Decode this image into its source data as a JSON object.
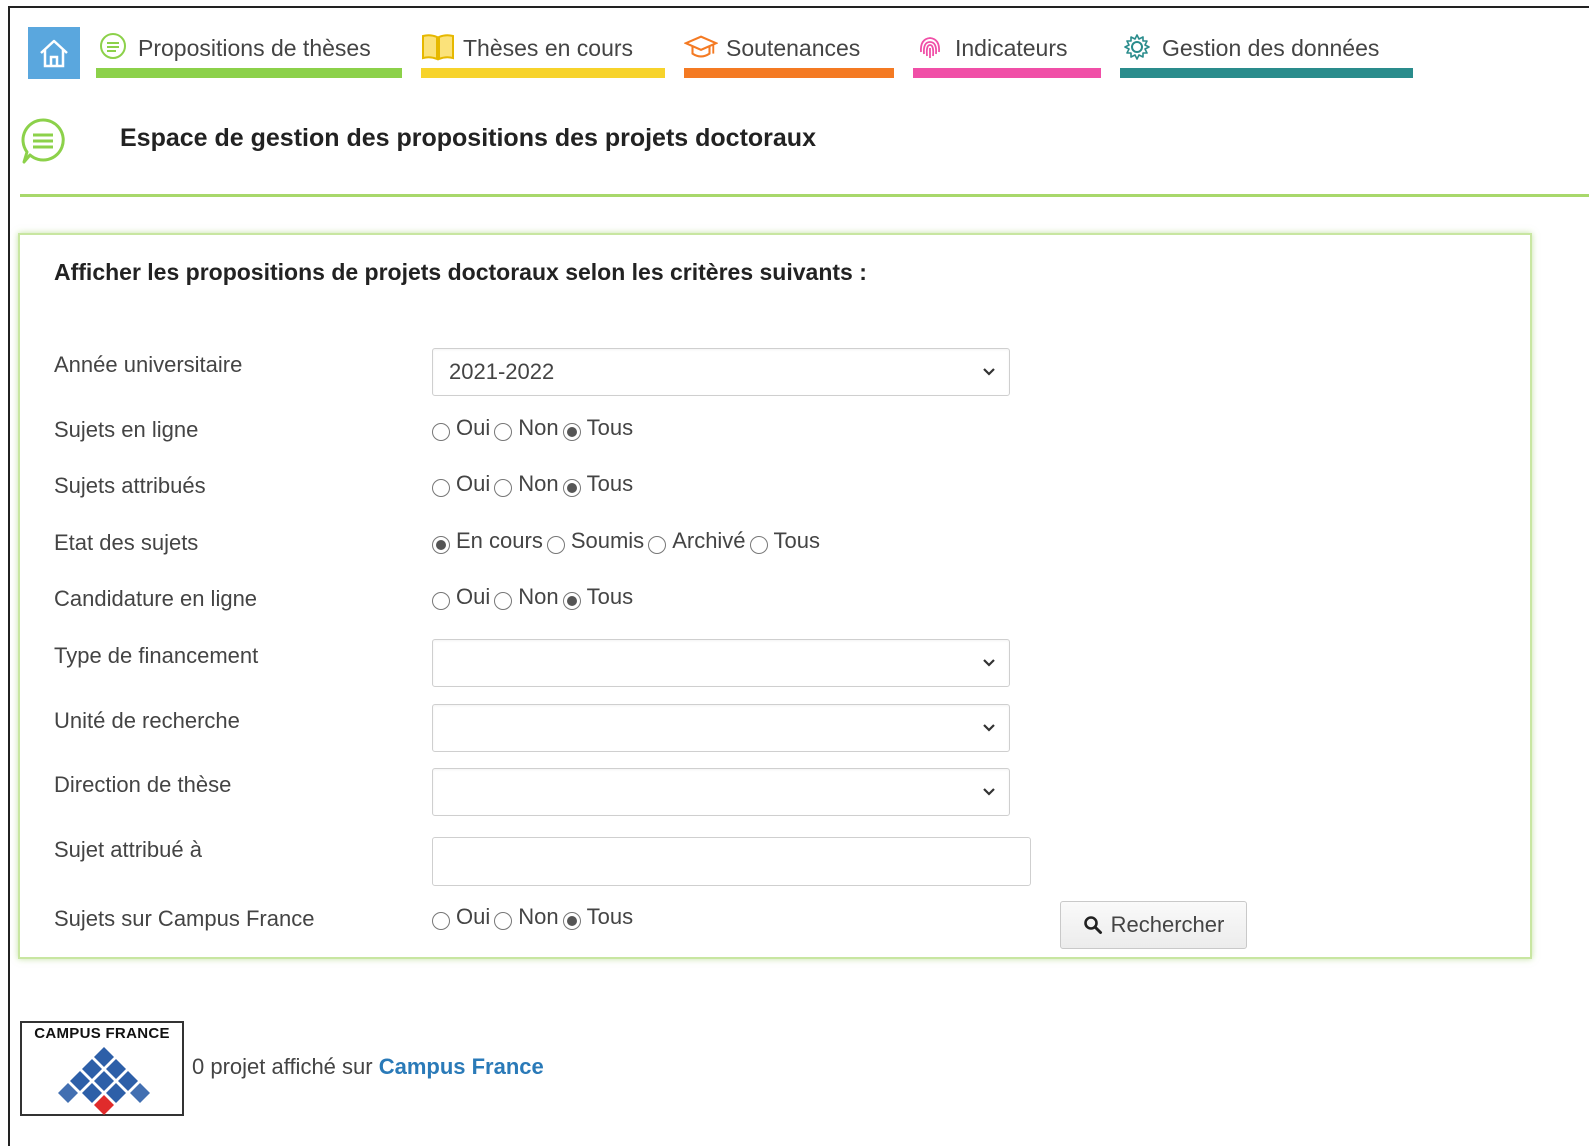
{
  "nav": {
    "items": [
      {
        "label": "Propositions de thèses",
        "icon": "speech-bubble-icon",
        "color": "#8cd14a"
      },
      {
        "label": "Thèses en cours",
        "icon": "open-book-icon",
        "color": "#f7d32b"
      },
      {
        "label": "Soutenances",
        "icon": "graduation-cap-icon",
        "color": "#f47a23"
      },
      {
        "label": "Indicateurs",
        "icon": "fingerprint-icon",
        "color": "#f04fa7"
      },
      {
        "label": "Gestion des données",
        "icon": "gear-icon",
        "color": "#2a8c8c"
      }
    ],
    "home_color": "#5aa7de"
  },
  "header": {
    "title": "Espace de gestion des propositions des projets doctoraux",
    "accent": "#8cd14a"
  },
  "form": {
    "title": "Afficher les propositions de projets doctoraux selon les critères suivants :",
    "annee": {
      "label": "Année universitaire",
      "value": "2021-2022"
    },
    "en_ligne": {
      "label": "Sujets en ligne",
      "options": [
        "Oui",
        "Non",
        "Tous"
      ],
      "selected": "Tous"
    },
    "attribues": {
      "label": "Sujets attribués",
      "options": [
        "Oui",
        "Non",
        "Tous"
      ],
      "selected": "Tous"
    },
    "etat": {
      "label": "Etat des sujets",
      "options": [
        "En cours",
        "Soumis",
        "Archivé",
        "Tous"
      ],
      "selected": "En cours"
    },
    "candidature": {
      "label": "Candidature en ligne",
      "options": [
        "Oui",
        "Non",
        "Tous"
      ],
      "selected": "Tous"
    },
    "financement": {
      "label": "Type de financement",
      "value": ""
    },
    "unite": {
      "label": "Unité de recherche",
      "value": ""
    },
    "direction": {
      "label": "Direction de thèse",
      "value": ""
    },
    "attribue_a": {
      "label": "Sujet attribué à",
      "value": ""
    },
    "campus": {
      "label": "Sujets sur Campus France",
      "options": [
        "Oui",
        "Non",
        "Tous"
      ],
      "selected": "Tous"
    },
    "search_label": "Rechercher"
  },
  "footer": {
    "logo_text": "CAMPUS FRANCE",
    "count_text": "0 projet affiché sur ",
    "link_text": "Campus France",
    "link_color": "#2a7ab8"
  }
}
